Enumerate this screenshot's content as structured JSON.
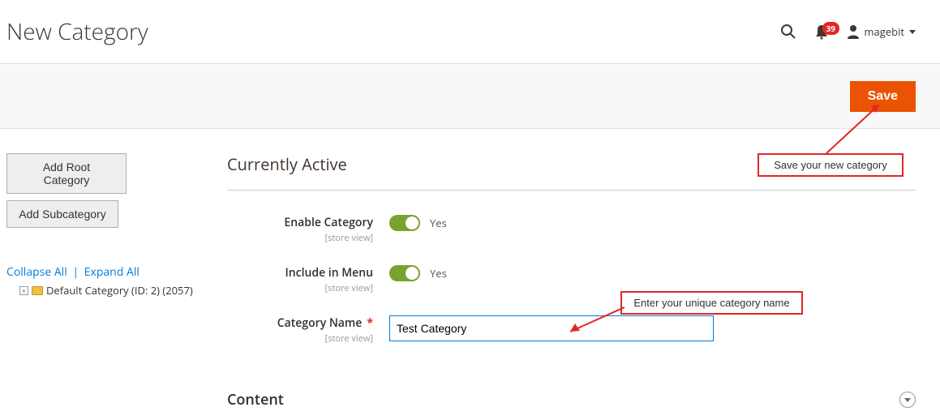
{
  "header": {
    "title": "New Category",
    "notification_count": "39",
    "username": "magebit"
  },
  "actions": {
    "save_label": "Save"
  },
  "sidebar": {
    "add_root_label": "Add Root Category",
    "add_sub_label": "Add Subcategory",
    "collapse_label": "Collapse All",
    "expand_label": "Expand All",
    "tree_item_label": "Default Category (ID: 2) (2057)"
  },
  "form": {
    "section_title": "Currently Active",
    "content_section": "Content",
    "scope_text": "[store view]",
    "fields": {
      "enable_category": {
        "label": "Enable Category",
        "value": "Yes"
      },
      "include_in_menu": {
        "label": "Include in Menu",
        "value": "Yes"
      },
      "category_name": {
        "label": "Category Name",
        "value": "Test Category"
      }
    }
  },
  "annotations": {
    "save_hint": "Save your new category",
    "name_hint": "Enter your unique category name"
  }
}
